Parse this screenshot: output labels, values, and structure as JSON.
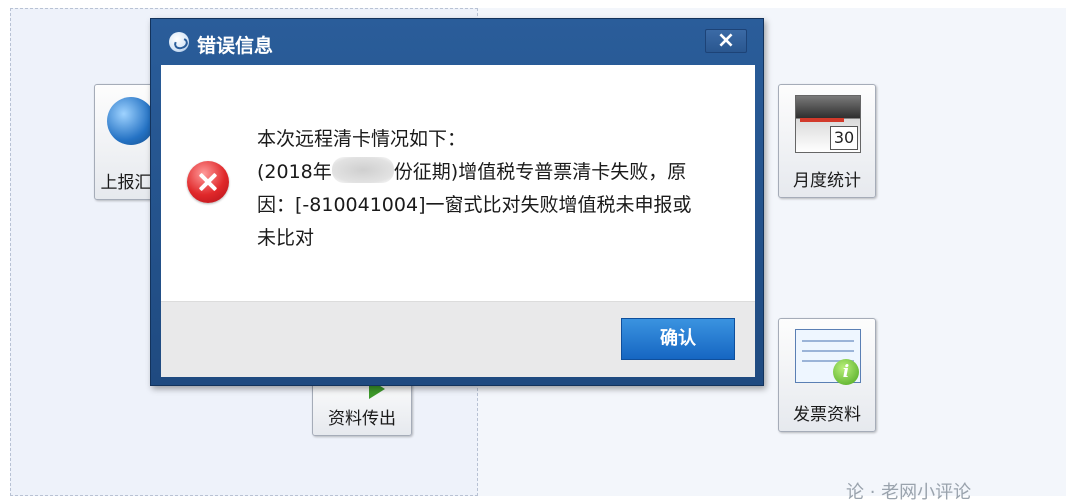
{
  "background": {
    "tiles": {
      "upload_label": "上报汇",
      "monthly_label": "月度统计",
      "monthly_day": "30",
      "export_label": "资料传出",
      "invoice_label": "发票资料",
      "invoice_badge": "i"
    },
    "watermark": "论 · 老网小评论"
  },
  "dialog": {
    "title": "错误信息",
    "close_symbol": "×",
    "message": {
      "line1": "本次远程清卡情况如下：",
      "line2_prefix": "(2018年",
      "line2_suffix": "份征期)增值税专普票清卡失败，原",
      "line3": "因：[-810041004]一窗式比对失败增值税未申报或",
      "line4": "未比对"
    },
    "ok_label": "确认"
  },
  "colors": {
    "titlebar": "#24528c",
    "ok_button": "#1f75d1",
    "error_icon": "#e0282a"
  }
}
